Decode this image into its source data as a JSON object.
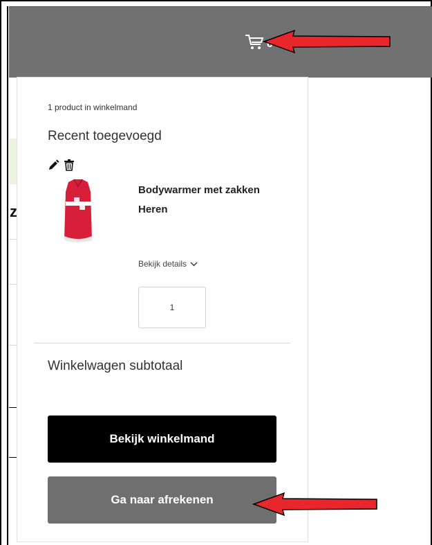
{
  "header": {
    "cart_icon": "cart-icon",
    "cart_count": "6"
  },
  "minicart": {
    "count_text": "1 product in winkelmand",
    "recent_title": "Recent toegevoegd",
    "icons": [
      "edit-icon",
      "trash-icon"
    ],
    "item": {
      "name": "Bodywarmer met zakken Heren",
      "details_label": "Bekijk details",
      "quantity": "1"
    },
    "subtotal_label": "Winkelwagen subtotaal",
    "view_cart_label": "Bekijk winkelmand",
    "checkout_label": "Ga naar afrekenen"
  },
  "colors": {
    "header_bg": "#717171",
    "primary_button": "#000000",
    "secondary_button": "#6f6f6f",
    "annotation_arrow": "#e8262b"
  }
}
